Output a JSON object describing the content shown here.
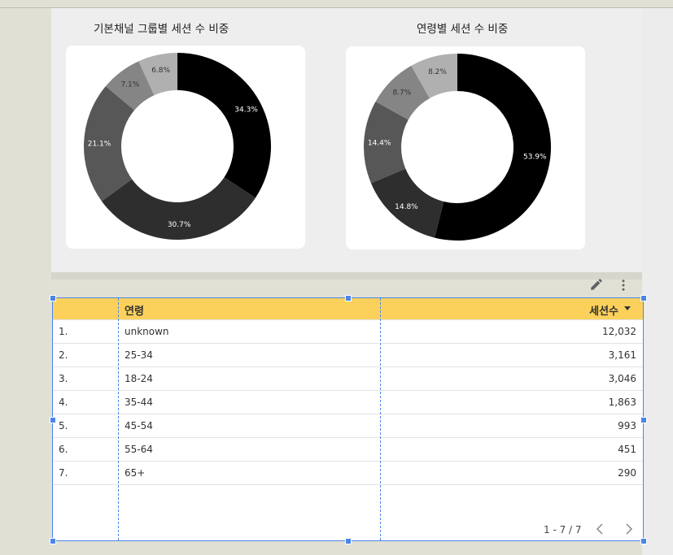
{
  "colors": {
    "header": "#fbd15b",
    "selection": "#4a86e8"
  },
  "charts": {
    "channel": {
      "title": "기본채널 그룹별 세션 수 비중",
      "chart_data": {
        "type": "pie",
        "title": "기본채널 그룹별 세션 수 비중",
        "slices": [
          {
            "value": 34.3,
            "label": "34.3%",
            "color": "#000000"
          },
          {
            "value": 30.7,
            "label": "30.7%",
            "color": "#2e2e2e"
          },
          {
            "value": 21.1,
            "label": "21.1%",
            "color": "#575757"
          },
          {
            "value": 7.1,
            "label": "7.1%",
            "color": "#858585"
          },
          {
            "value": 6.8,
            "label": "6.8%",
            "color": "#b0b0b0"
          }
        ]
      }
    },
    "age": {
      "title": "연령별 세션 수 비중",
      "chart_data": {
        "type": "pie",
        "title": "연령별 세션 수 비중",
        "slices": [
          {
            "value": 53.9,
            "label": "53.9%",
            "color": "#000000"
          },
          {
            "value": 14.8,
            "label": "14.8%",
            "color": "#2e2e2e"
          },
          {
            "value": 14.4,
            "label": "14.4%",
            "color": "#575757"
          },
          {
            "value": 8.7,
            "label": "8.7%",
            "color": "#858585"
          },
          {
            "value": 8.2,
            "label": "8.2%",
            "color": "#b0b0b0"
          }
        ]
      }
    }
  },
  "toolbar": {
    "edit_icon": "pencil-icon",
    "more_icon": "more-vert-icon"
  },
  "table": {
    "columns": {
      "dimension": "연령",
      "metric": "세션수",
      "sort_icon": "sort-desc-icon"
    },
    "rows": [
      {
        "index": "1.",
        "age": "unknown",
        "sessions": "12,032"
      },
      {
        "index": "2.",
        "age": "25-34",
        "sessions": "3,161"
      },
      {
        "index": "3.",
        "age": "18-24",
        "sessions": "3,046"
      },
      {
        "index": "4.",
        "age": "35-44",
        "sessions": "1,863"
      },
      {
        "index": "5.",
        "age": "45-54",
        "sessions": "993"
      },
      {
        "index": "6.",
        "age": "55-64",
        "sessions": "451"
      },
      {
        "index": "7.",
        "age": "65+",
        "sessions": "290"
      }
    ],
    "pagination": "1 - 7 / 7"
  }
}
